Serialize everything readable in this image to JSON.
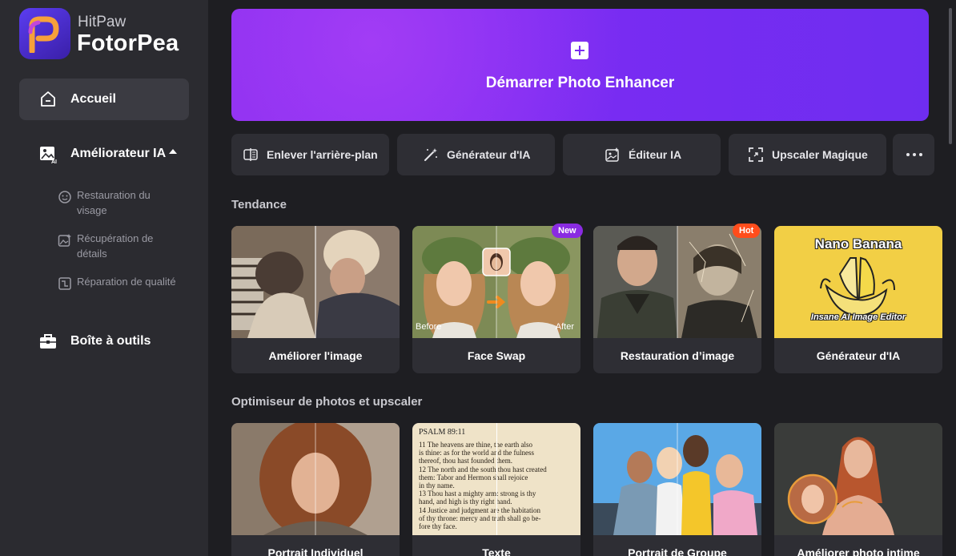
{
  "brand": {
    "sub": "HitPaw",
    "main": "FotorPea"
  },
  "sidebar": {
    "home": "Accueil",
    "enhancer": "Améliorateur IA",
    "sub_items": [
      "Restauration du visage",
      "Récupération de détails",
      "Réparation de qualité"
    ],
    "toolbox": "Boîte à outils"
  },
  "banner": {
    "label": "Démarrer Photo Enhancer"
  },
  "tools": [
    "Enlever l'arrière-plan",
    "Générateur d'IA",
    "Éditeur IA",
    "Upscaler Magique"
  ],
  "sections": {
    "trending": "Tendance",
    "optimizer": "Optimiseur de photos et upscaler"
  },
  "trending_cards": [
    "Améliorer l'image",
    "Face Swap",
    "Restauration d’image",
    "Générateur d'IA"
  ],
  "badges": {
    "new": "New",
    "hot": "Hot"
  },
  "faceswap": {
    "before": "Before",
    "after": "After"
  },
  "nano": {
    "title": "Nano Banana",
    "sub": "Insane AI Image Editor"
  },
  "optimizer_cards": [
    "Portrait Individuel",
    "Texte",
    "Portrait de Groupe",
    "Améliorer photo intime"
  ],
  "psalm": {
    "head": "PSALM 89:11",
    "lines": [
      "11 The heavens are thine, the earth also",
      "is thine: as for the world and the fulness",
      "thereof, thou hast founded them.",
      "12 The north and the south thou hast created",
      "them: Tabor and Hermon shall rejoice",
      "in thy name.",
      "13 Thou hast a mighty arm: strong is thy",
      "hand, and high is thy right hand.",
      "14 Justice and judgment are the habitation",
      "of thy throne: mercy and truth shall go be-",
      "fore thy face."
    ]
  },
  "colors": {
    "accent": "#7a2ef0",
    "badge_new": "#8a2be2",
    "badge_hot": "#ff4d1c",
    "sidebar": "#2b2b30",
    "main": "#1e1e22"
  }
}
